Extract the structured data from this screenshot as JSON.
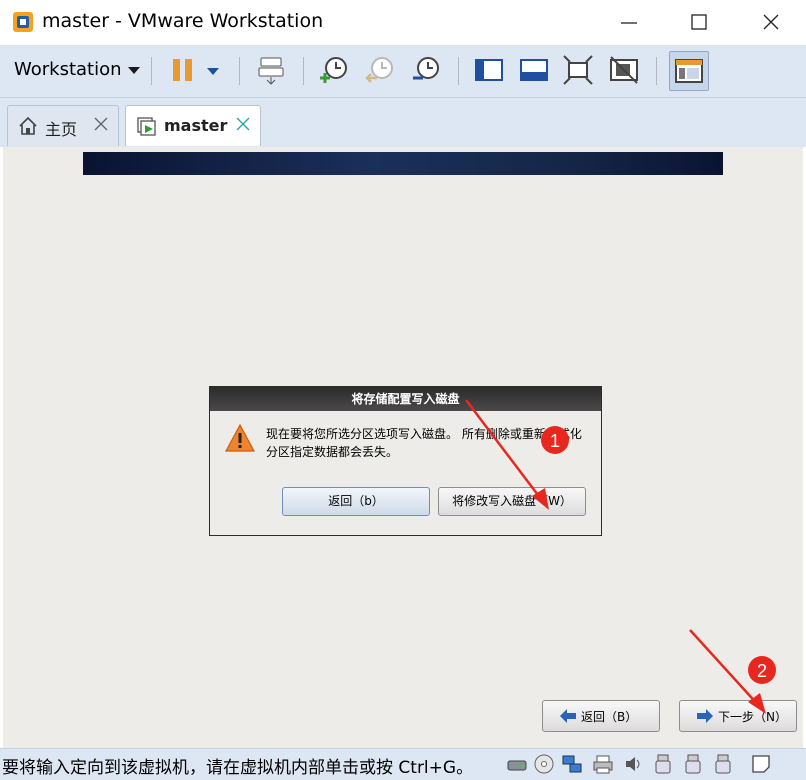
{
  "window": {
    "title": "master - VMware Workstation"
  },
  "toolbar": {
    "menu_label": "Workstation",
    "icons": [
      "pause-icon",
      "dropdown-icon",
      "send-keys-icon",
      "snapshot-take-icon",
      "snapshot-revert-icon",
      "snapshot-manager-icon",
      "console-view-icon",
      "fit-window-icon",
      "full-screen-icon",
      "unity-icon",
      "library-icon"
    ]
  },
  "tabs": [
    {
      "label": "主页",
      "icon": "home-icon"
    },
    {
      "label": "master",
      "icon": "vm-icon",
      "active": true
    }
  ],
  "dialog": {
    "title": "将存储配置写入磁盘",
    "message": "现在要将您所选分区选项写入磁盘。 所有删除或重新格式化分区指定数据都会丢失。",
    "back_label": "返回（b）",
    "write_label": "将修改写入磁盘（W）"
  },
  "installer": {
    "back_label": "返回（B）",
    "next_label": "下一步（N）"
  },
  "annotations": {
    "step1": "1",
    "step2": "2",
    "color": "#e8281f"
  },
  "status": {
    "text": "要将输入定向到该虚拟机，请在虚拟机内部单击或按 Ctrl+G。",
    "device_icons": [
      "hard-disk-icon",
      "cd-dvd-icon",
      "network-icon",
      "printer-icon",
      "sound-icon",
      "usb-icon",
      "usb-icon",
      "usb-icon",
      "message-icon"
    ]
  }
}
